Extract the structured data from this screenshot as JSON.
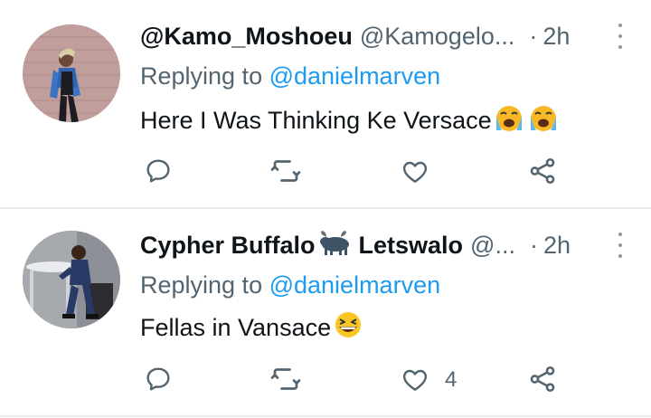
{
  "replies": [
    {
      "display_name": "@Kamo_Moshoeu",
      "handle": "@Kamogelo...",
      "dot": "·",
      "time": "2h",
      "replying_prefix": "Replying to ",
      "replying_to": "@danielmarven",
      "text": "Here I Was Thinking Ke Versace",
      "emojis": [
        "loudly-crying-face",
        "loudly-crying-face"
      ],
      "like_count": ""
    },
    {
      "display_name": "Cypher Buffalo",
      "display_name_suffix": "Letswalo",
      "name_emoji": "water-buffalo",
      "handle": "@...",
      "dot": "·",
      "time": "2h",
      "replying_prefix": "Replying to ",
      "replying_to": "@danielmarven",
      "text": "Fellas in Vansace",
      "emojis": [
        "grinning-squinting-face"
      ],
      "like_count": "4"
    }
  ],
  "icons": {
    "reply": "reply-bubble-icon",
    "retweet": "retweet-icon",
    "like": "heart-icon",
    "share": "share-icon",
    "more": "more-vertical-icon"
  },
  "colors": {
    "link": "#1d9bf0",
    "secondary_text": "#536471",
    "primary_text": "#0f1419",
    "divider": "#e6ecf0"
  }
}
